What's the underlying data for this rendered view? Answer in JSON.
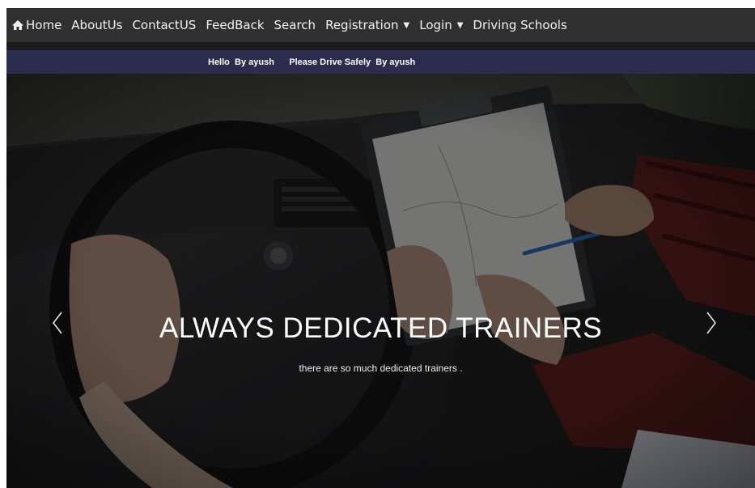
{
  "navbar": {
    "items": [
      {
        "label": "Home",
        "icon": "home-icon"
      },
      {
        "label": "AboutUs"
      },
      {
        "label": "ContactUS"
      },
      {
        "label": "FeedBack"
      },
      {
        "label": "Search"
      },
      {
        "label": "Registration",
        "dropdown": true
      },
      {
        "label": "Login",
        "dropdown": true
      },
      {
        "label": "Driving Schools"
      }
    ]
  },
  "marquee": {
    "text": "Hello  By ayush      Please Drive Safely  By ayush"
  },
  "carousel": {
    "title": "ALWAYS DEDICATED TRAINERS",
    "subtitle": "there are so much dedicated trainers .",
    "prev_icon": "chevron-left-icon",
    "next_icon": "chevron-right-icon"
  },
  "colors": {
    "navbar_bg": "#303030",
    "marquee_bg": "#2b2c4e",
    "caption_text": "#ffffff"
  }
}
